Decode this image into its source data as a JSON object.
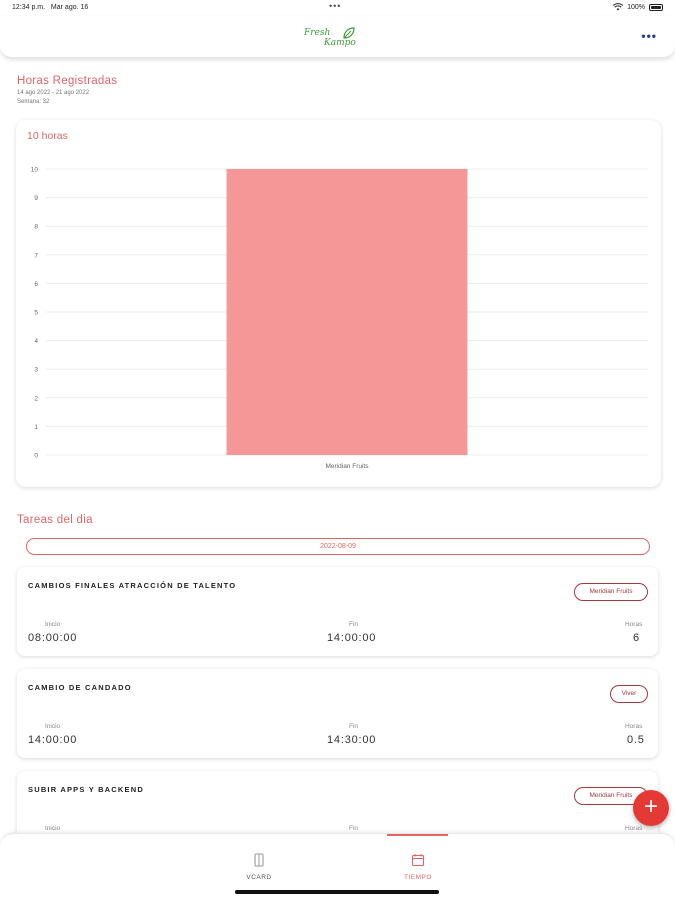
{
  "status_bar": {
    "time": "12:34 p.m.",
    "date": "Mar ago. 16",
    "battery": "100%",
    "icons": [
      "wifi-icon",
      "battery-icon"
    ]
  },
  "header": {
    "logo_line1": "Fresh",
    "logo_line2": "Kampo",
    "menu_icon": "more-horizontal-icon"
  },
  "summary": {
    "title": "Horas Registradas",
    "date_range": "14 ago 2022 - 21 ago 2022",
    "week": "Semana: 32"
  },
  "chart_data": {
    "type": "bar",
    "title": "10 horas",
    "categories": [
      "Meridian Fruits"
    ],
    "values": [
      10
    ],
    "ylim": [
      0,
      10
    ],
    "yticks": [
      0,
      1,
      2,
      3,
      4,
      5,
      6,
      7,
      8,
      9,
      10
    ],
    "grid": true,
    "bar_color": "#f59797"
  },
  "tasks_section": {
    "title": "Tareas del dia",
    "date": "2022-08-09",
    "col_start": "Inicio",
    "col_end": "Fin",
    "col_hours": "Horas"
  },
  "tasks": [
    {
      "name": "CAMBIOS FINALES ATRACCIÓN DE TALENTO",
      "client": "Meridian Fruits",
      "start": "08:00:00",
      "end": "14:00:00",
      "hours": "6"
    },
    {
      "name": "CAMBIO DE CANDADO",
      "client": "Viver",
      "start": "14:00:00",
      "end": "14:30:00",
      "hours": "0.5"
    },
    {
      "name": "SUBIR APPS Y BACKEND",
      "client": "Meridian Fruits",
      "start": "",
      "end": "",
      "hours": ""
    }
  ],
  "tabs": [
    {
      "label": "VCARD",
      "icon": "vcard-icon",
      "active": false
    },
    {
      "label": "TIEMPO",
      "icon": "clock-icon",
      "active": true
    }
  ],
  "fab": {
    "label": "+",
    "icon": "add-icon"
  },
  "colors": {
    "accent": "#e06666",
    "badge": "#a33b3b",
    "fab": "#e53935",
    "logo_green": "#3b9b3b"
  }
}
